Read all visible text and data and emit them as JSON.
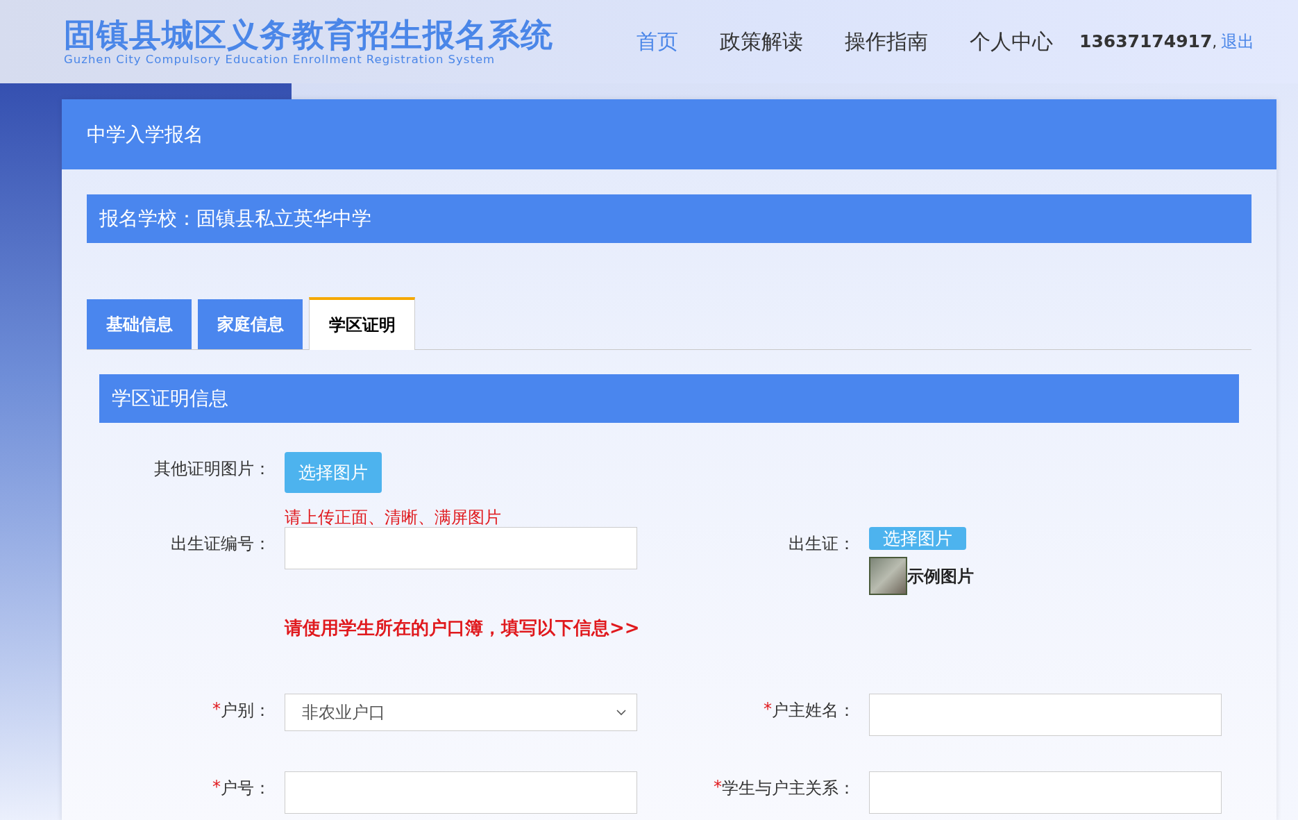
{
  "header": {
    "title": "固镇县城区义务教育招生报名系统",
    "subtitle": "Guzhen City Compulsory Education Enrollment Registration System",
    "nav": [
      {
        "label": "首页",
        "selected": true
      },
      {
        "label": "政策解读",
        "selected": false
      },
      {
        "label": "操作指南",
        "selected": false
      },
      {
        "label": "个人中心",
        "selected": false
      }
    ],
    "user": {
      "phone": "13637174917",
      "separator": ",",
      "logout": "退出"
    }
  },
  "page_title": "中学入学报名",
  "school_bar": "报名学校：固镇县私立英华中学",
  "tabs": [
    {
      "label": "基础信息",
      "selected": false
    },
    {
      "label": "家庭信息",
      "selected": false
    },
    {
      "label": "学区证明",
      "selected": true
    }
  ],
  "section_title": "学区证明信息",
  "other_proof": {
    "label": "其他证明图片：",
    "button": "选择图片",
    "hint": "请上传正面、清晰、满屏图片"
  },
  "birth_cert_no": {
    "label": "出生证编号："
  },
  "birth_cert": {
    "label": "出生证：",
    "button": "选择图片",
    "example": "示例图片"
  },
  "notice": "请使用学生所在的户口簿，填写以下信息>>",
  "household_fields": [
    {
      "kind": "select",
      "mark": "*",
      "label": "户别：",
      "value": "非农业户口"
    },
    {
      "kind": "text",
      "mark": "*",
      "label": "户主姓名："
    },
    {
      "kind": "text",
      "mark": "*",
      "label": "户号："
    },
    {
      "kind": "text",
      "mark": "*",
      "label": "学生与户主关系："
    }
  ]
}
